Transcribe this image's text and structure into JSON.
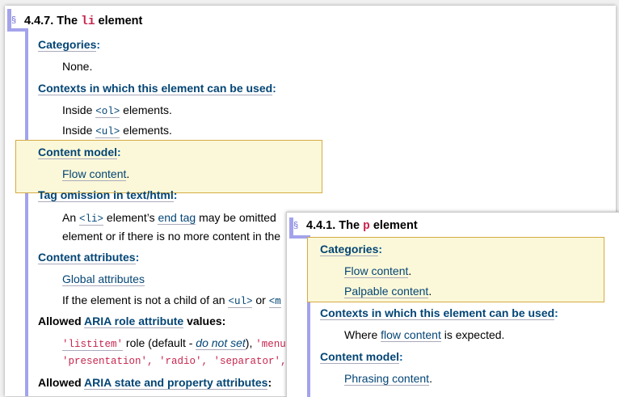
{
  "li_section": {
    "section_sign": "§",
    "title_prefix": "4.4.7. The ",
    "title_code": "li",
    "title_suffix": " element",
    "categories_label": "Categories",
    "categories_value": "None.",
    "contexts_label": "Contexts in which this element can be used",
    "contexts_ol_pre": "Inside ",
    "contexts_ol_code": "<ol>",
    "contexts_ol_post": " elements.",
    "contexts_ul_pre": "Inside ",
    "contexts_ul_code": "<ul>",
    "contexts_ul_post": " elements.",
    "content_model_label": "Content model",
    "content_model_value": "Flow content",
    "tag_omission_label": "Tag omission in text/html",
    "tag_om_line1_pre": "An ",
    "tag_om_line1_code": "<li>",
    "tag_om_line1_mid": " element’s ",
    "tag_om_line1_link": "end tag",
    "tag_om_line1_post": " may be omitted",
    "tag_om_line2": "element or if there is no more content in the",
    "content_attrs_label": "Content attributes",
    "global_attrs": "Global attributes",
    "if_line_pre": "If the element is not a child of an ",
    "if_line_code1": "<ul>",
    "if_line_mid": " or ",
    "if_line_code2": "<m",
    "aria_role_pre": "Allowed ",
    "aria_role_link": "ARIA role attribute",
    "aria_role_post": " values:",
    "role_line1_q": "'listitem'",
    "role_line1_mid": " role (default - ",
    "role_line1_it": "do not set",
    "role_line1_post": "), ",
    "role_line1_q2": "'menu",
    "role_line2": "'presentation', 'radio', 'separator', 'tab",
    "aria_state_pre": "Allowed ",
    "aria_state_link": "ARIA state and property attributes",
    "aria_state_post": ":"
  },
  "p_section": {
    "section_sign": "§",
    "title_prefix": "4.4.1. The ",
    "title_code": "p",
    "title_suffix": " element",
    "categories_label": "Categories",
    "flow_content": "Flow content",
    "palpable_content": "Palpable content",
    "contexts_label": "Contexts in which this element can be used",
    "where_pre": "Where ",
    "where_link": "flow content",
    "where_post": " is expected.",
    "content_model_label": "Content model",
    "phrasing_content": "Phrasing content"
  },
  "colors": {
    "highlight_bg": "#fbf8d9",
    "highlight_border": "#d6aa45",
    "section_bar": "#a3a3ec",
    "term_color": "#005a9c",
    "code_color": "#c7254e"
  }
}
